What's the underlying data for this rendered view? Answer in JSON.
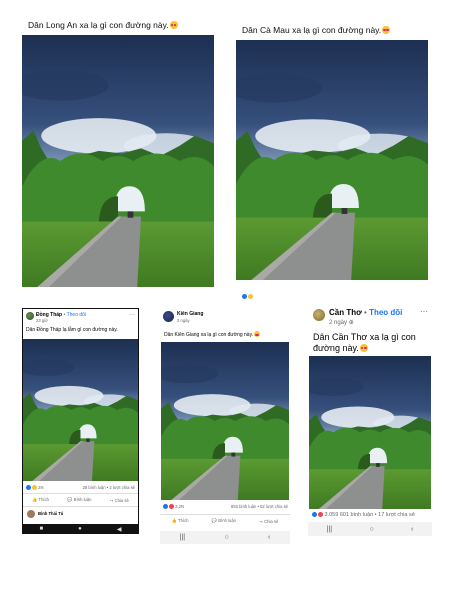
{
  "post1": {
    "caption": "Dân Long An xa lạ gì con đường này."
  },
  "post2": {
    "caption": "Dân Cà Mau xa lạ gì con đường này."
  },
  "post3": {
    "page_name": "Đồng Tháp",
    "follow": "Theo dõi",
    "time": "23 giờ",
    "caption": "Dân Đồng Tháp lạ lẫm gì con đường này.",
    "reactions": "2N",
    "stats": "28 bình luận • 2 lượt chia sẻ",
    "like": "Thích",
    "comment": "Bình luận",
    "share": "Chia sẻ",
    "commenter": "Bình Thái Tú"
  },
  "post4": {
    "page_name": "Kiên Giang",
    "time": "2 ngày",
    "caption": "Dân Kiên Giang xa lạ gì con đường này.",
    "reactions": "3,2N",
    "stats": "893 bình luận • 52 lượt chia sẻ",
    "like": "Thích",
    "comment": "Bình luận",
    "share": "Chia sẻ"
  },
  "post5": {
    "page_name": "Cần Thơ",
    "follow": "Theo dõi",
    "time": "2 ngày",
    "caption_line1": "Dân Cần Thơ xa lạ gì con",
    "caption_line2": "đường này.",
    "stats": "3.059  601 bình luận • 17 lượt chia sẻ"
  },
  "colors": {
    "fb_blue": "#1877f2",
    "phone_black": "#111111"
  }
}
